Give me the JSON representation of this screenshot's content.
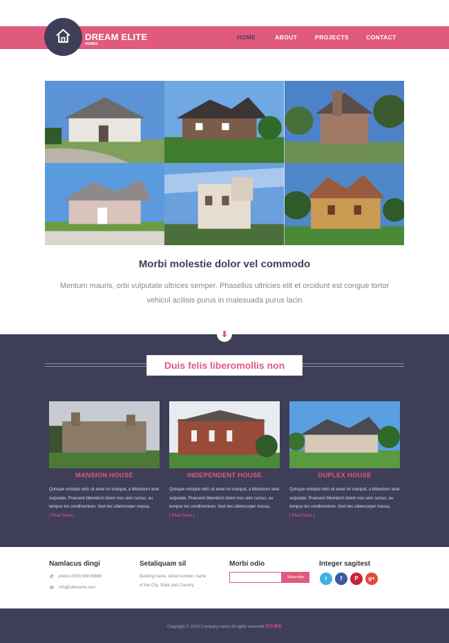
{
  "header": {
    "brand": "DREAM ELITE",
    "brand_sub": "HOMES",
    "nav": [
      {
        "label": "HOME"
      },
      {
        "label": "ABOUT"
      },
      {
        "label": "PROJECTS"
      },
      {
        "label": "CONTACT"
      }
    ]
  },
  "intro": {
    "title": "Morbi molestie dolor vel commodo",
    "text": "Mentum mauris, orbi vulputate ultrices semper. Phasellus ultricies elit et orcidunt est congue tortor vehicul acilisis purus in malesuada purus lacin"
  },
  "section": {
    "heading": "Duis felis liberomollis non",
    "arrow": "⬇",
    "cards": [
      {
        "title": "MANSION HOUSE",
        "text": "Quisque volutpat odio sit amet mi volutpat, a bibendum ante vulputate. Praesent bibendum lorem non sem cursus, eu tempus leo condimentum. Sed nec ullamcorper massa.",
        "link": "[ Read More ]"
      },
      {
        "title": "INDEPENDENT HOUSE",
        "text": "Quisque volutpat odio sit amet mi volutpat, a bibendum ante vulputate. Praesent bibendum lorem non sem cursus, eu tempus leo condimentum. Sed nec ullamcorper massa.",
        "link": "[ Read More ]"
      },
      {
        "title": "DUPLEX HOUSE",
        "text": "Quisque volutpat odio sit amet mi volutpat, a bibendum ante vulputate. Praesent bibendum lorem non sem cursus, eu tempus leo condimentum. Sed nec ullamcorper massa.",
        "link": "[ Read More ]"
      }
    ]
  },
  "footer": {
    "col1": {
      "title": "Namlacus dingi",
      "phone": "phone:(000) 888 88888",
      "email": "info@sitename.com"
    },
    "col2": {
      "title": "Setaliquam sil",
      "line1": "Building name, street number, name",
      "line2": "of the City, State and Country."
    },
    "col3": {
      "title": "Morbi odio",
      "input_placeholder": "",
      "button": "Subscribe"
    },
    "col4": {
      "title": "Integer sagitest",
      "icons": [
        "twitter-icon",
        "facebook-icon",
        "pinterest-icon",
        "google-plus-icon"
      ]
    },
    "copyright": "Copyright © 2015 Company name All rights reserved.",
    "copyright_accent": "网页模板"
  },
  "colors": {
    "accent": "#e05a7b",
    "dark": "#3f3e59"
  }
}
